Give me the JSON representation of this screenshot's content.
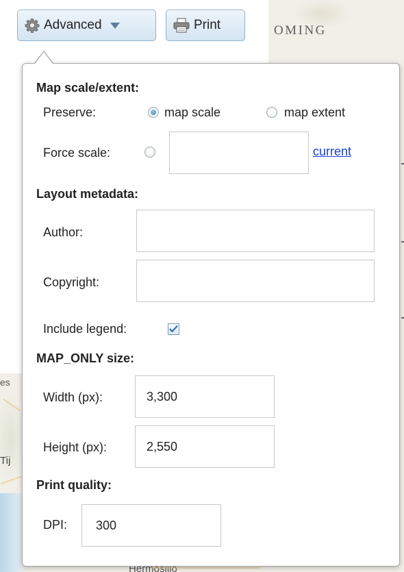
{
  "toolbar": {
    "advanced_label": "Advanced",
    "advanced_icon": "gear-icon",
    "advanced_caret_icon": "caret-down-icon",
    "print_label": "Print",
    "print_icon": "printer-icon"
  },
  "map": {
    "label_oming": "OMING",
    "label_es": "es",
    "label_tij": "Tij",
    "label_bottom": "Hermosillo"
  },
  "panel": {
    "map_scale_extent": {
      "heading": "Map scale/extent:",
      "preserve_label": "Preserve:",
      "option_map_scale": "map scale",
      "option_map_extent": "map extent",
      "preserve_selected": "map scale",
      "force_scale_label": "Force scale:",
      "force_scale_value": "",
      "current_link": "current"
    },
    "layout_metadata": {
      "heading": "Layout metadata:",
      "author_label": "Author:",
      "author_value": "",
      "copyright_label": "Copyright:",
      "copyright_value": "",
      "include_legend_label": "Include legend:",
      "include_legend_checked": true
    },
    "map_only_size": {
      "heading": "MAP_ONLY size:",
      "width_label": "Width (px):",
      "width_value": "3,300",
      "height_label": "Height (px):",
      "height_value": "2,550"
    },
    "print_quality": {
      "heading": "Print quality:",
      "dpi_label": "DPI:",
      "dpi_value": "300"
    }
  },
  "colors": {
    "button_border": "#8fb1cf",
    "link": "#1a3fd1",
    "radio_selected": "#3f7fb8"
  }
}
